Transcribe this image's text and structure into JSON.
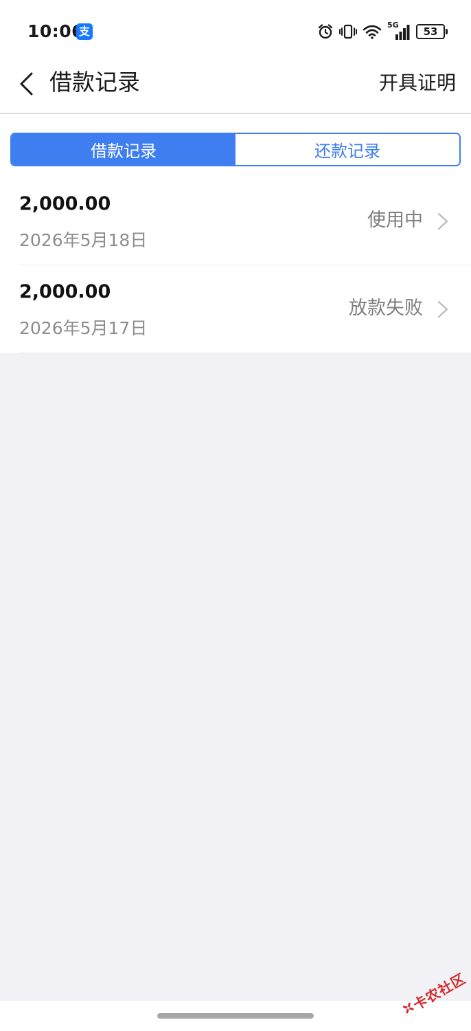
{
  "status_bar": {
    "time": "10:06",
    "app_badge": "支",
    "network_label": "5G",
    "battery": "53"
  },
  "header": {
    "title": "借款记录",
    "action_label": "开具证明"
  },
  "tabs": [
    {
      "label": "借款记录",
      "active": true
    },
    {
      "label": "还款记录",
      "active": false
    }
  ],
  "records": [
    {
      "amount": "2,000.00",
      "date": "2026年5月18日",
      "status": "使用中"
    },
    {
      "amount": "2,000.00",
      "date": "2026年5月17日",
      "status": "放款失败"
    }
  ],
  "watermark": {
    "text": "卡农社区"
  },
  "colors": {
    "accent": "#3E7EF0",
    "page_bg": "#F1F1F6",
    "card_bg": "#FFFFFF",
    "secondary_text": "#8C8C8C",
    "watermark": "#D42A2A"
  }
}
